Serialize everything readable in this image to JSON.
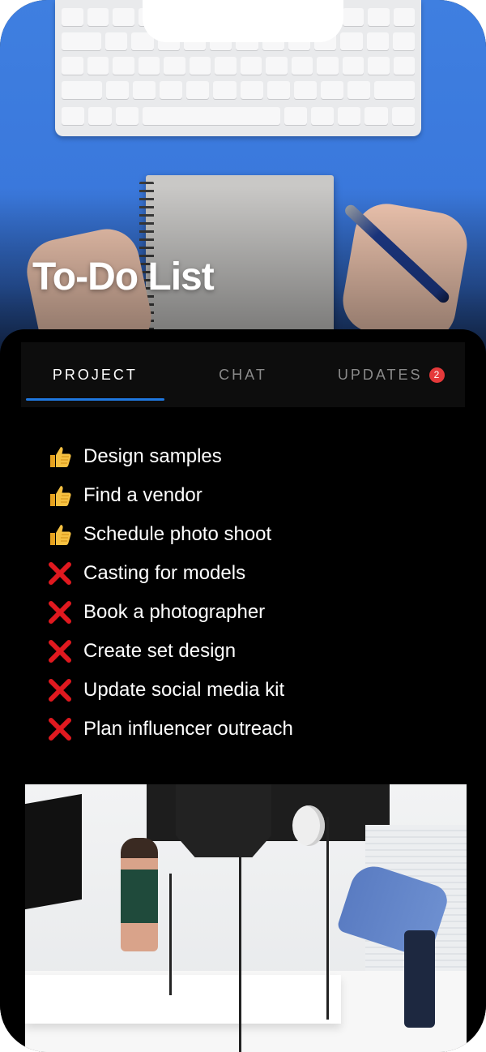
{
  "header": {
    "title": "To-Do List"
  },
  "tabs": [
    {
      "label": "PROJECT",
      "active": true
    },
    {
      "label": "CHAT",
      "active": false
    },
    {
      "label": "UPDATES",
      "active": false,
      "badge": "2"
    }
  ],
  "tasks": [
    {
      "label": "Design samples",
      "status_icon": "thumbs-up-icon"
    },
    {
      "label": "Find a vendor",
      "status_icon": "thumbs-up-icon"
    },
    {
      "label": "Schedule photo shoot",
      "status_icon": "thumbs-up-icon"
    },
    {
      "label": "Casting for models",
      "status_icon": "cross-mark-icon"
    },
    {
      "label": "Book a photographer",
      "status_icon": "cross-mark-icon"
    },
    {
      "label": "Create set design",
      "status_icon": "cross-mark-icon"
    },
    {
      "label": "Update social media kit",
      "status_icon": "cross-mark-icon"
    },
    {
      "label": "Plan influencer outreach",
      "status_icon": "cross-mark-icon"
    }
  ],
  "colors": {
    "accent": "#1f78e0",
    "badge": "#e5393a",
    "panel_bg": "#000000",
    "hero_blue": "#3a78dc",
    "cross": "#e0191f",
    "thumb": "#f2b233"
  }
}
